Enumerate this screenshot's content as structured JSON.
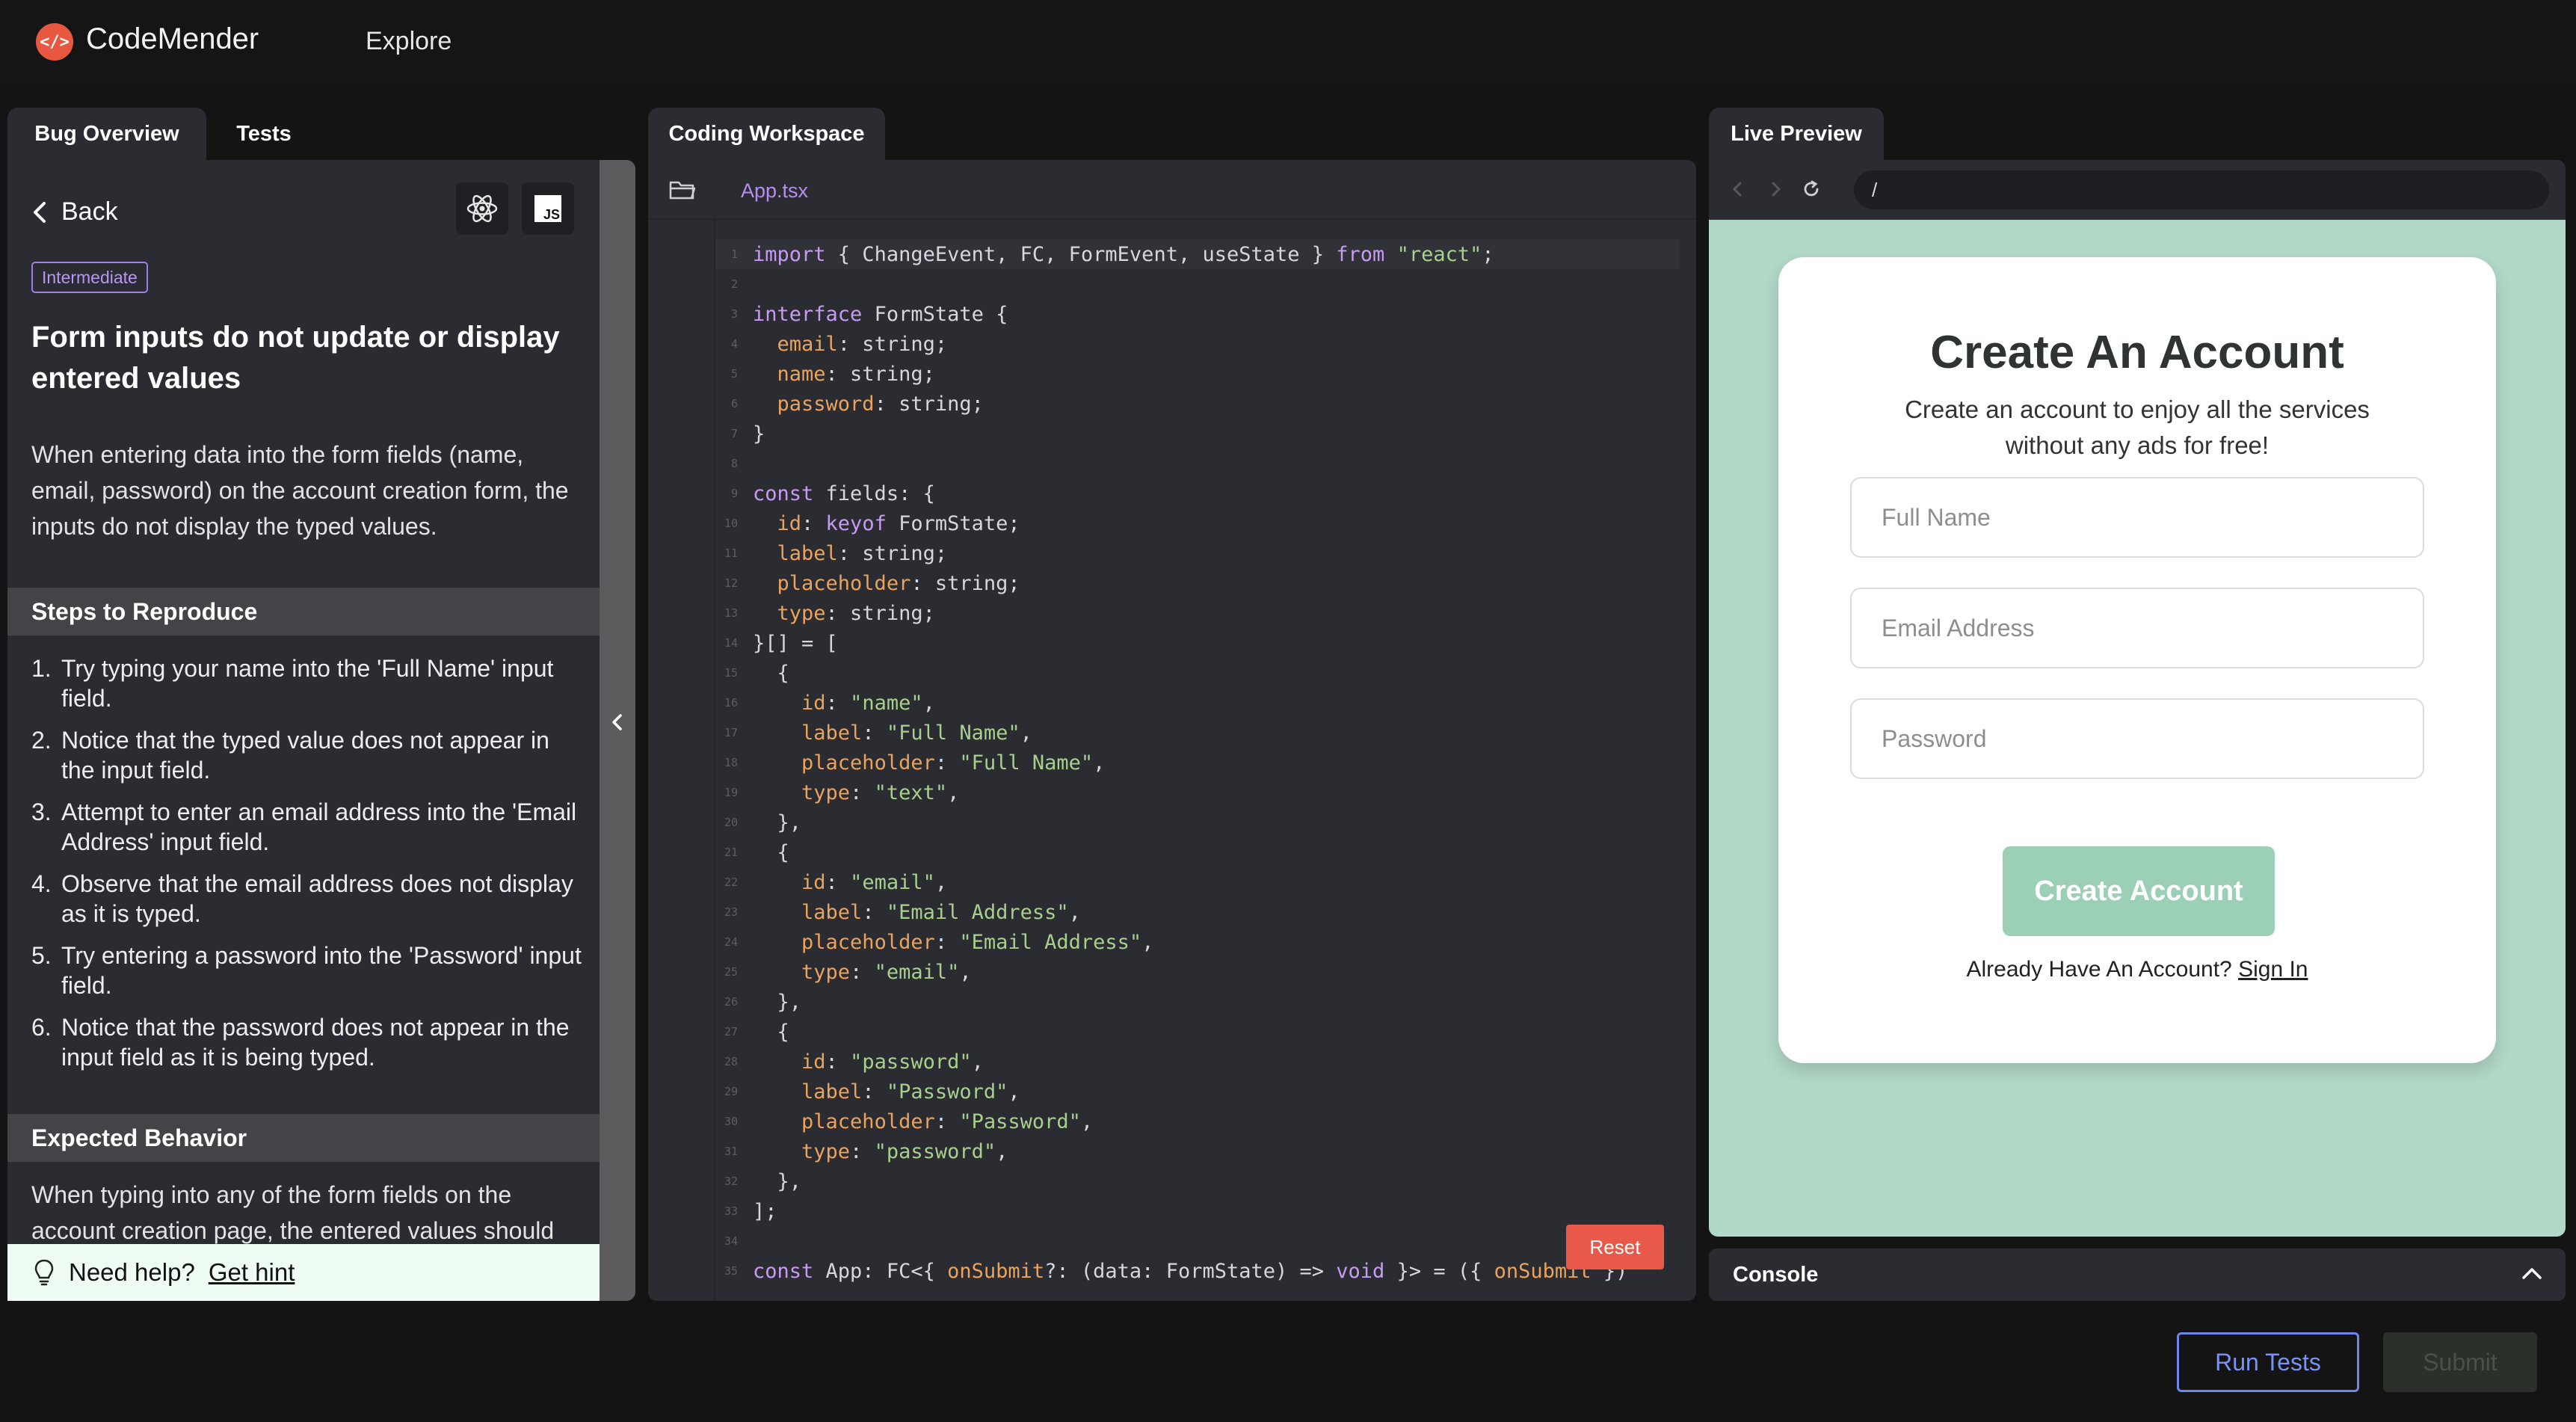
{
  "header": {
    "logo_glyph": "</>",
    "brand": "CodeMender",
    "nav_explore": "Explore"
  },
  "left_tabs": [
    {
      "label": "Bug Overview",
      "active": true
    },
    {
      "label": "Tests",
      "active": false
    }
  ],
  "bug": {
    "back_label": "Back",
    "icons": [
      "react-icon",
      "javascript-icon"
    ],
    "js_glyph": "JS",
    "difficulty": "Intermediate",
    "title": "Form inputs do not update or display entered values",
    "description": "When entering data into the form fields (name, email, password) on the account creation form, the inputs do not display the typed values.",
    "steps_heading": "Steps to Reproduce",
    "steps": [
      "Try typing your name into the 'Full Name' input field.",
      "Notice that the typed value does not appear in the input field.",
      "Attempt to enter an email address into the 'Email Address' input field.",
      "Observe that the email address does not display as it is typed.",
      "Try entering a password into the 'Password' input field.",
      "Notice that the password does not appear in the input field as it is being typed."
    ],
    "expected_heading": "Expected Behavior",
    "expected": "When typing into any of the form fields on the account creation page, the entered values should",
    "help_text": "Need help?",
    "hint_link": "Get hint"
  },
  "workspace": {
    "tab_label": "Coding Workspace",
    "file_name": "App.tsx",
    "reset_label": "Reset",
    "lines": [
      [
        [
          "kw",
          "import"
        ],
        [
          "p",
          " { ChangeEvent, FC, FormEvent, useState } "
        ],
        [
          "kw",
          "from"
        ],
        [
          "p",
          " "
        ],
        [
          "str",
          "\"react\""
        ],
        [
          "p",
          ";"
        ]
      ],
      [],
      [
        [
          "kw",
          "interface"
        ],
        [
          "p",
          " FormState {"
        ]
      ],
      [
        [
          "p",
          "  "
        ],
        [
          "prop",
          "email"
        ],
        [
          "p",
          ": string;"
        ]
      ],
      [
        [
          "p",
          "  "
        ],
        [
          "prop",
          "name"
        ],
        [
          "p",
          ": string;"
        ]
      ],
      [
        [
          "p",
          "  "
        ],
        [
          "prop",
          "password"
        ],
        [
          "p",
          ": string;"
        ]
      ],
      [
        [
          "p",
          "}"
        ]
      ],
      [],
      [
        [
          "kw",
          "const"
        ],
        [
          "p",
          " fields: {"
        ]
      ],
      [
        [
          "p",
          "  "
        ],
        [
          "prop",
          "id"
        ],
        [
          "p",
          ": "
        ],
        [
          "kw",
          "keyof"
        ],
        [
          "p",
          " FormState;"
        ]
      ],
      [
        [
          "p",
          "  "
        ],
        [
          "prop",
          "label"
        ],
        [
          "p",
          ": string;"
        ]
      ],
      [
        [
          "p",
          "  "
        ],
        [
          "prop",
          "placeholder"
        ],
        [
          "p",
          ": string;"
        ]
      ],
      [
        [
          "p",
          "  "
        ],
        [
          "prop",
          "type"
        ],
        [
          "p",
          ": string;"
        ]
      ],
      [
        [
          "p",
          "}[] = ["
        ]
      ],
      [
        [
          "p",
          "  {"
        ]
      ],
      [
        [
          "p",
          "    "
        ],
        [
          "prop",
          "id"
        ],
        [
          "p",
          ": "
        ],
        [
          "str",
          "\"name\""
        ],
        [
          "p",
          ","
        ]
      ],
      [
        [
          "p",
          "    "
        ],
        [
          "prop",
          "label"
        ],
        [
          "p",
          ": "
        ],
        [
          "str",
          "\"Full Name\""
        ],
        [
          "p",
          ","
        ]
      ],
      [
        [
          "p",
          "    "
        ],
        [
          "prop",
          "placeholder"
        ],
        [
          "p",
          ": "
        ],
        [
          "str",
          "\"Full Name\""
        ],
        [
          "p",
          ","
        ]
      ],
      [
        [
          "p",
          "    "
        ],
        [
          "prop",
          "type"
        ],
        [
          "p",
          ": "
        ],
        [
          "str",
          "\"text\""
        ],
        [
          "p",
          ","
        ]
      ],
      [
        [
          "p",
          "  },"
        ]
      ],
      [
        [
          "p",
          "  {"
        ]
      ],
      [
        [
          "p",
          "    "
        ],
        [
          "prop",
          "id"
        ],
        [
          "p",
          ": "
        ],
        [
          "str",
          "\"email\""
        ],
        [
          "p",
          ","
        ]
      ],
      [
        [
          "p",
          "    "
        ],
        [
          "prop",
          "label"
        ],
        [
          "p",
          ": "
        ],
        [
          "str",
          "\"Email Address\""
        ],
        [
          "p",
          ","
        ]
      ],
      [
        [
          "p",
          "    "
        ],
        [
          "prop",
          "placeholder"
        ],
        [
          "p",
          ": "
        ],
        [
          "str",
          "\"Email Address\""
        ],
        [
          "p",
          ","
        ]
      ],
      [
        [
          "p",
          "    "
        ],
        [
          "prop",
          "type"
        ],
        [
          "p",
          ": "
        ],
        [
          "str",
          "\"email\""
        ],
        [
          "p",
          ","
        ]
      ],
      [
        [
          "p",
          "  },"
        ]
      ],
      [
        [
          "p",
          "  {"
        ]
      ],
      [
        [
          "p",
          "    "
        ],
        [
          "prop",
          "id"
        ],
        [
          "p",
          ": "
        ],
        [
          "str",
          "\"password\""
        ],
        [
          "p",
          ","
        ]
      ],
      [
        [
          "p",
          "    "
        ],
        [
          "prop",
          "label"
        ],
        [
          "p",
          ": "
        ],
        [
          "str",
          "\"Password\""
        ],
        [
          "p",
          ","
        ]
      ],
      [
        [
          "p",
          "    "
        ],
        [
          "prop",
          "placeholder"
        ],
        [
          "p",
          ": "
        ],
        [
          "str",
          "\"Password\""
        ],
        [
          "p",
          ","
        ]
      ],
      [
        [
          "p",
          "    "
        ],
        [
          "prop",
          "type"
        ],
        [
          "p",
          ": "
        ],
        [
          "str",
          "\"password\""
        ],
        [
          "p",
          ","
        ]
      ],
      [
        [
          "p",
          "  },"
        ]
      ],
      [
        [
          "p",
          "];"
        ]
      ],
      [],
      [
        [
          "kw",
          "const"
        ],
        [
          "p",
          " App: FC<{ "
        ],
        [
          "prop",
          "onSubmit"
        ],
        [
          "p",
          "?: (data: FormState) => "
        ],
        [
          "kw",
          "void"
        ],
        [
          "p",
          " }> = ({ "
        ],
        [
          "prop",
          "onSubmit"
        ],
        [
          "p",
          " })"
        ]
      ]
    ]
  },
  "preview": {
    "tab_label": "Live Preview",
    "url": "/",
    "title": "Create An Account",
    "subtitle": "Create an account to enjoy all the services without any ads for free!",
    "fields": [
      {
        "placeholder": "Full Name"
      },
      {
        "placeholder": "Email Address"
      },
      {
        "placeholder": "Password"
      }
    ],
    "create_button": "Create Account",
    "signin_prompt": "Already Have An Account?",
    "signin_link": "Sign In",
    "bg_color": "#b2d8c7"
  },
  "console": {
    "label": "Console"
  },
  "actions": {
    "run_tests": "Run Tests",
    "submit": "Submit"
  },
  "colors": {
    "accent_orange": "#e8573f",
    "badge_purple": "#a27ce8",
    "run_tests_blue": "#6e86e8",
    "reset_red": "#e9594a"
  }
}
